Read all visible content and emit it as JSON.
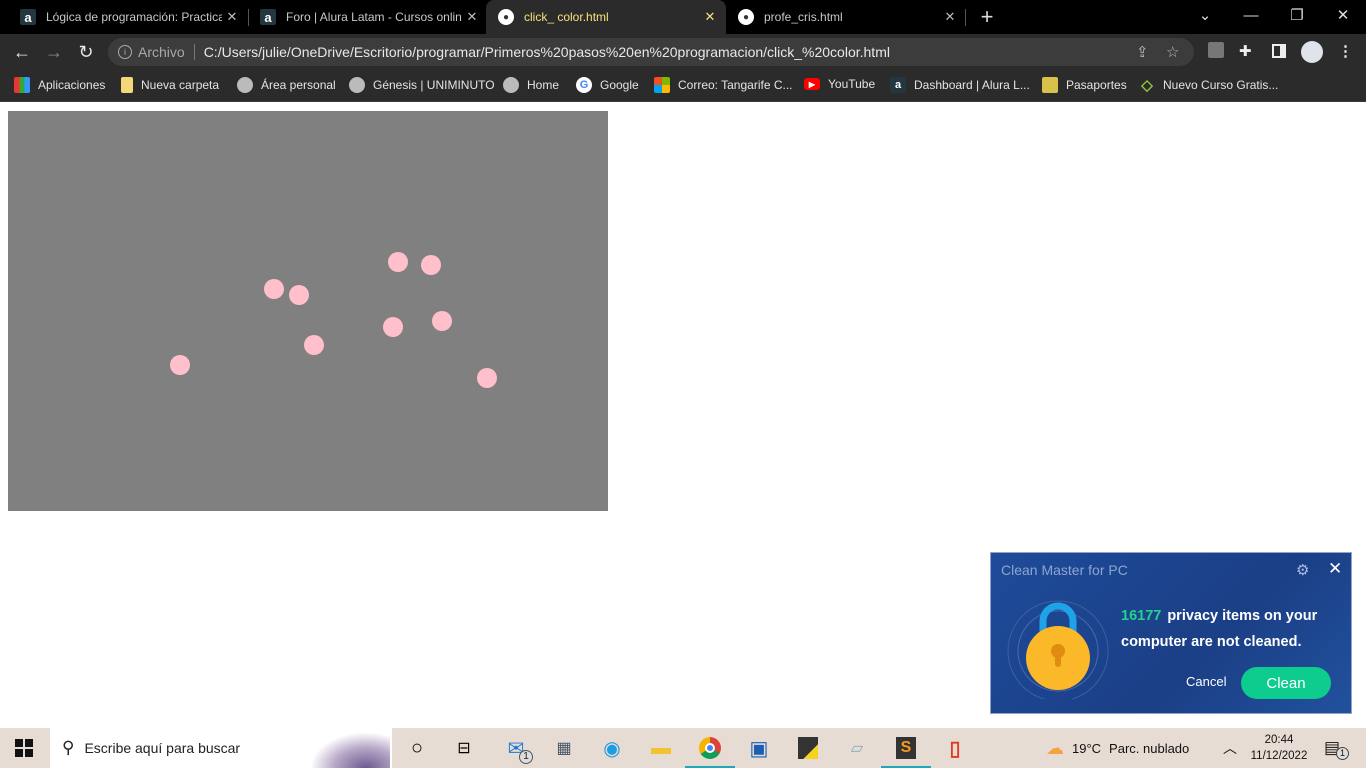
{
  "browser": {
    "tabs": [
      {
        "title": "Lógica de programación: Practica",
        "icon": "alura-icon",
        "active": false
      },
      {
        "title": "Foro | Alura Latam - Cursos onlin",
        "icon": "alura-icon",
        "active": false
      },
      {
        "title": "click_ color.html",
        "icon": "globe-icon",
        "active": true
      },
      {
        "title": "profe_cris.html",
        "icon": "globe-icon",
        "active": false
      }
    ],
    "new_tab": "+",
    "address": {
      "scheme_label": "Archivo",
      "url": "C:/Users/julie/OneDrive/Escritorio/programar/Primeros%20pasos%20en%20programacion/click_%20color.html"
    },
    "bookmarks": [
      {
        "label": "Aplicaciones",
        "icon": "apps-grid-icon"
      },
      {
        "label": "Nueva carpeta",
        "icon": "folder-icon"
      },
      {
        "label": "Área personal",
        "icon": "globe-icon"
      },
      {
        "label": "Génesis | UNIMINUTO",
        "icon": "globe-icon"
      },
      {
        "label": "Home",
        "icon": "globe-icon"
      },
      {
        "label": "Google",
        "icon": "google-icon"
      },
      {
        "label": "Correo: Tangarife C...",
        "icon": "microsoft-icon"
      },
      {
        "label": "YouTube",
        "icon": "youtube-icon"
      },
      {
        "label": "Dashboard | Alura L...",
        "icon": "alura-icon"
      },
      {
        "label": "Pasaportes",
        "icon": "shield-crest-icon"
      },
      {
        "label": "Nuevo Curso Gratis...",
        "icon": "diamond-icon"
      }
    ]
  },
  "page": {
    "canvas_color": "#808080",
    "dot_color": "#ffc0cb",
    "dot_count": 9
  },
  "popup": {
    "title": "Clean Master for PC",
    "count": "16177",
    "message": "privacy items on your computer are not cleaned.",
    "cancel": "Cancel",
    "clean": "Clean",
    "accent": "#0ecb8e"
  },
  "taskbar": {
    "search_placeholder": "Escribe aquí para buscar",
    "mail_badge": "1",
    "weather_temp": "19°C",
    "weather_desc": "Parc. nublado",
    "time": "20:44",
    "date": "11/12/2022",
    "notifications": "1"
  }
}
